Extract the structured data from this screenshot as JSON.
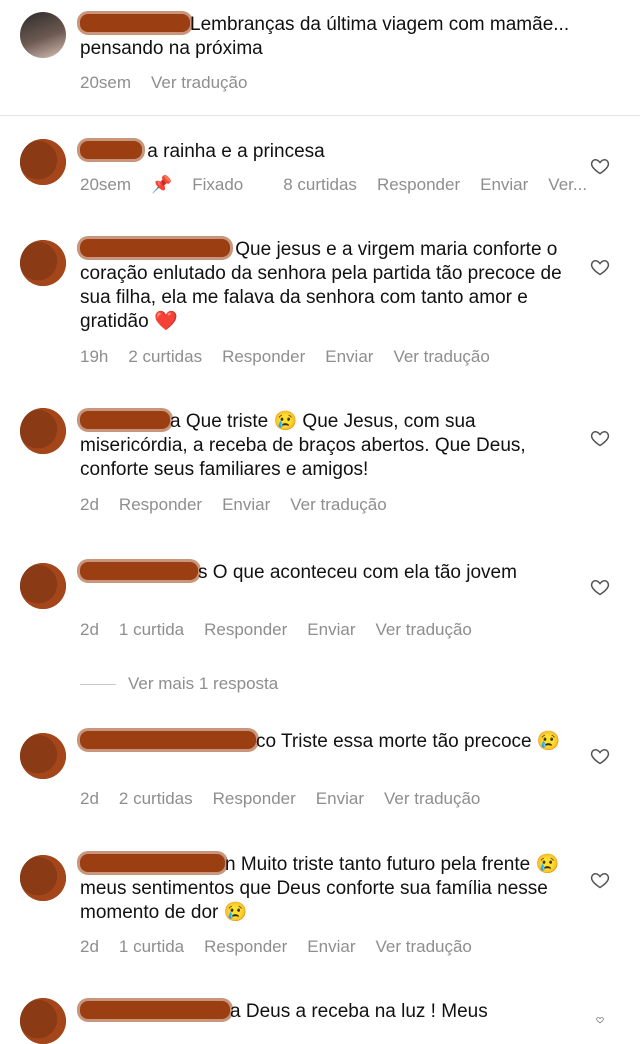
{
  "caption": {
    "text": "Lembranças da última viagem com mamãe... pensando na próxima",
    "time": "20sem",
    "translate": "Ver tradução"
  },
  "comments": [
    {
      "text": "a rainha e a princesa",
      "time": "20sem",
      "pinned": "Fixado",
      "likes": "8 curtidas",
      "reply": "Responder",
      "send": "Enviar",
      "translate": "Ver..."
    },
    {
      "text": "Que jesus e a virgem maria conforte o coração enlutado da senhora pela partida tão precoce de sua filha, ela me falava da senhora com tanto amor e gratidão ❤️",
      "time": "19h",
      "likes": "2 curtidas",
      "reply": "Responder",
      "send": "Enviar",
      "translate": "Ver tradução"
    },
    {
      "text": "a Que triste 😢 Que Jesus, com sua misericórdia, a  receba de braços abertos. Que Deus, conforte seus familiares e amigos!",
      "time": "2d",
      "reply": "Responder",
      "send": "Enviar",
      "translate": "Ver tradução"
    },
    {
      "text": "s O que aconteceu com ela tão jovem",
      "time": "2d",
      "likes": "1 curtida",
      "reply": "Responder",
      "send": "Enviar",
      "translate": "Ver tradução"
    },
    {
      "text": "co Triste essa morte tão precoce 😢",
      "time": "2d",
      "likes": "2 curtidas",
      "reply": "Responder",
      "send": "Enviar",
      "translate": "Ver tradução"
    },
    {
      "text": "n Muito triste tanto futuro pela frente 😢 meus sentimentos que Deus conforte sua família nesse momento de dor 😢",
      "time": "2d",
      "likes": "1 curtida",
      "reply": "Responder",
      "send": "Enviar",
      "translate": "Ver tradução"
    },
    {
      "text": "a Deus a receba na luz ! Meus"
    }
  ],
  "more_replies": "Ver mais 1 resposta",
  "icons": {
    "heart": "heart-outline-icon",
    "pin": "pin-icon"
  }
}
